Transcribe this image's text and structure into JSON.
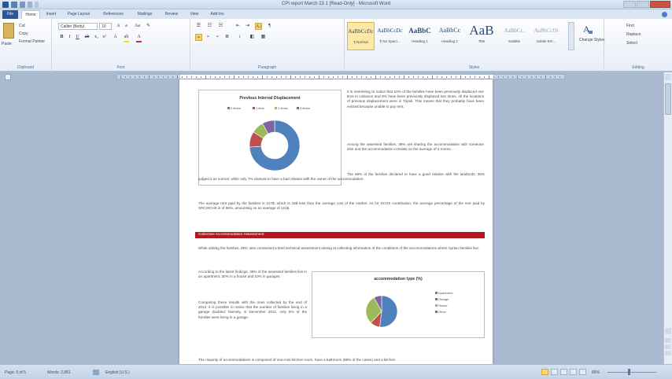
{
  "window": {
    "title": "CPI report March 23 1 [Read-Only] - Microsoft Word"
  },
  "tabs": [
    "File",
    "Home",
    "Insert",
    "Page Layout",
    "References",
    "Mailings",
    "Review",
    "View",
    "Add-Ins"
  ],
  "ribbon": {
    "clipboard": {
      "paste": "Paste",
      "cut": "Cut",
      "copy": "Copy",
      "format_painter": "Format Painter",
      "label": "Clipboard"
    },
    "font": {
      "name": "Calibri (Body)",
      "size": "10",
      "label": "Font"
    },
    "paragraph": {
      "label": "Paragraph"
    },
    "styles": {
      "label": "Styles",
      "items": [
        {
          "sample": "AaBbCcDc",
          "name": "¶ Normal"
        },
        {
          "sample": "AaBbCcDc",
          "name": "¶ No Spaci..."
        },
        {
          "sample": "AaBbC",
          "name": "Heading 1"
        },
        {
          "sample": "AaBbCc",
          "name": "Heading 2"
        },
        {
          "sample": "AaB",
          "name": "Title"
        },
        {
          "sample": "AaBbCc.",
          "name": "Subtitle"
        },
        {
          "sample": "AaBbCcDt",
          "name": "Subtle Em..."
        }
      ],
      "change_styles": "Change Styles"
    },
    "editing": {
      "find": "Find",
      "replace": "Replace",
      "select": "Select",
      "label": "Editing"
    }
  },
  "document": {
    "para1": "It is interesting to notice that 10% of the families have been previously displaced one time in Lebanon and 8% have been previously displaced two times. All the locations of previous displacement were in Tripoli. This means that they probably have been evicted because unable to pay rent.",
    "para2": "Among the assessed families, 38% are sharing the accommodation with someone else and the accommodation consists on the average of 2 rooms.",
    "para3": "The 58% of the families declared to have a good relation with the landlords; 35% judged it as normal, while only 7% claimed to have a bad relation with the owner of the accommodation.",
    "para4": "The average rent paid by the families is 217$, which is 18$ less than the average cost of the market. As for SCHS contribution, the average percentage of the rent paid by SRC/SCHS is of 58%, amounting on an average of 121$.",
    "section_title": "Collective Accommodation Assessment",
    "para5": "While visiting the families, SRC also conducted a brief technical assessment aiming at collecting information of the conditions of the accommodations where Syrian families live.",
    "para6": "According to the latest findings, 38% of the assessed families live in an apartment, 30% in a house and 10% in garages.",
    "para7": "Comparing these results with the ones collected by the end of 2012, it is possible to notice that the number of families living in a garage doubled. Namely, in December 2012, only 5% of the families were living in a garage.",
    "para8": "The majority of accommodations is composed of one-mini-kitchen room, have a bathroom (98% of the cases) and a kitchen"
  },
  "chart_data": [
    {
      "type": "pie",
      "title": "Previous Internal Displacement",
      "categories": [
        "0 times",
        "1 time",
        "2 times",
        "3 times"
      ],
      "values": [
        74,
        10,
        8,
        8
      ],
      "colors": [
        "#4f81bd",
        "#c0504d",
        "#9bbb59",
        "#8064a2"
      ],
      "legend": "top",
      "style": "doughnut"
    },
    {
      "type": "pie",
      "title": "accommodation type (%)",
      "categories": [
        "Apartment",
        "Garage",
        "House",
        "Other"
      ],
      "values": [
        52,
        10,
        30,
        8
      ],
      "colors": [
        "#4f81bd",
        "#c0504d",
        "#9bbb59",
        "#8064a2"
      ],
      "legend": "right"
    }
  ],
  "status": {
    "page": "Page: 5 of 5",
    "words": "Words: 2,881",
    "language": "English (U.S.)",
    "zoom": "89%"
  }
}
